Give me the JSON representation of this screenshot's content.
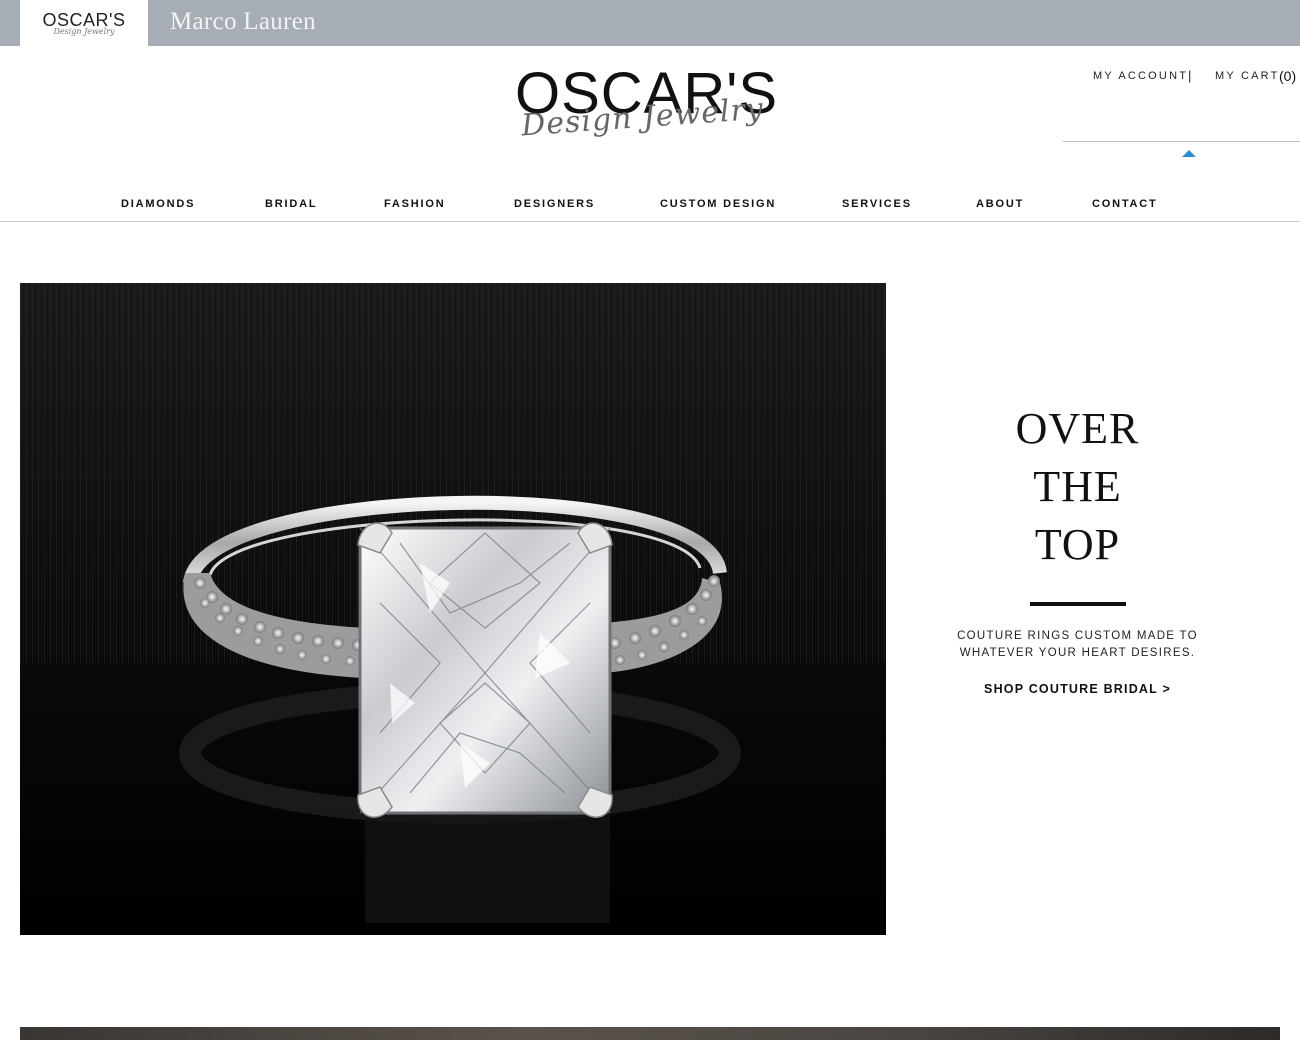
{
  "brand_tabs": {
    "active_word": "OSCAR'S",
    "active_script": "Design Jewelry",
    "second": "Marco Lauren"
  },
  "header": {
    "logo_word": "OSCAR'S",
    "logo_script": "Design Jewelry",
    "my_account": "MY ACCOUNT",
    "separator": "|",
    "my_cart": "MY CART",
    "cart_count": "(0)"
  },
  "nav": {
    "items": [
      "DIAMONDS",
      "BRIDAL",
      "FASHION",
      "DESIGNERS",
      "CUSTOM DESIGN",
      "SERVICES",
      "ABOUT",
      "CONTACT"
    ]
  },
  "promo": {
    "title_lines": [
      "OVER",
      "THE",
      "TOP"
    ],
    "desc_line1": "COUTURE RINGS CUSTOM MADE TO",
    "desc_line2": "WHATEVER YOUR HEART DESIRES.",
    "cta": "SHOP COUTURE BRIDAL >"
  },
  "colors": {
    "brand_strip": "#a7adb5",
    "search_caret": "#2b8fd0",
    "hero_background": "#050505"
  },
  "icons": {
    "search_caret": "caret-up-icon"
  }
}
